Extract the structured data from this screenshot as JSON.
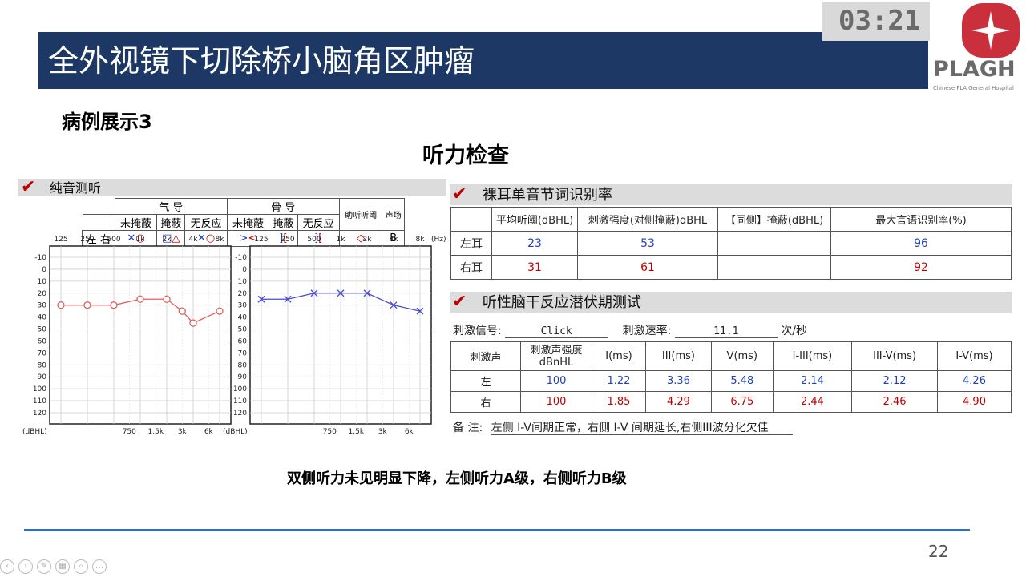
{
  "slide": {
    "title": "全外视镜下切除桥小脑角区肿瘤",
    "case_label": "病例展示3",
    "section_title": "听力检查",
    "summary": "双侧听力未见明显下降，左侧听力A级，右侧听力B级",
    "page_number": "22",
    "timer": "03:21"
  },
  "logo": {
    "text": "PLAGH",
    "subtext": "Chinese PLA General Hospital"
  },
  "pure_tone": {
    "header": "纯音测听",
    "legend": {
      "air": "气 导",
      "bone": "骨 导",
      "aid": "助听听阈",
      "field": "声场",
      "unmasked": "未掩蔽",
      "masked": "掩蔽",
      "no_response": "无反应",
      "left": "左",
      "right": "右",
      "field_symbol": "B"
    },
    "freq_labels": [
      "125",
      "250",
      "500",
      "1k",
      "2k",
      "4k",
      "8k"
    ],
    "hz": "(Hz)",
    "sub_freq_labels": [
      "750",
      "1.5k",
      "3k",
      "6k"
    ],
    "db_labels": [
      "-10",
      "0",
      "10",
      "20",
      "30",
      "40",
      "50",
      "60",
      "70",
      "80",
      "90",
      "100",
      "110",
      "120"
    ],
    "unit": "(dBHL)"
  },
  "chart_data": [
    {
      "type": "line",
      "title": "",
      "xlabel": "(Hz)",
      "ylabel": "(dBHL)",
      "x": [
        "125",
        "250",
        "500",
        "1k",
        "2k",
        "3k",
        "4k",
        "8k"
      ],
      "ylim": [
        -10,
        120
      ],
      "y_inverted": true,
      "series": [
        {
          "name": "右",
          "color": "#e06060",
          "values": [
            30,
            30,
            30,
            25,
            25,
            35,
            45,
            35
          ]
        }
      ]
    },
    {
      "type": "line",
      "title": "",
      "xlabel": "(Hz)",
      "ylabel": "(dBHL)",
      "x": [
        "125",
        "250",
        "500",
        "1k",
        "2k",
        "4k",
        "8k"
      ],
      "ylim": [
        -10,
        120
      ],
      "y_inverted": true,
      "series": [
        {
          "name": "左",
          "color": "#4a4ad0",
          "values": [
            25,
            25,
            20,
            20,
            20,
            30,
            35
          ]
        }
      ]
    }
  ],
  "speech": {
    "header": "裸耳单音节词识别率",
    "columns": [
      "",
      "平均听阈(dBHL)",
      "刺激强度(对侧掩蔽)dBHL",
      "【同侧】掩蔽(dBHL)",
      "最大言语识别率(%)"
    ],
    "rows": [
      {
        "ear": "左耳",
        "avg": "23",
        "intensity": "53",
        "mask": "",
        "max": "96"
      },
      {
        "ear": "右耳",
        "avg": "31",
        "intensity": "61",
        "mask": "",
        "max": "92"
      }
    ]
  },
  "abr": {
    "header": "听性脑干反应潜伏期测试",
    "signal_label": "刺激信号:",
    "signal_value": "Click",
    "rate_label": "刺激速率:",
    "rate_value": "11.1",
    "rate_unit": "次/秒",
    "columns": [
      "刺激声",
      "刺激声强度 dBnHL",
      "I(ms)",
      "III(ms)",
      "V(ms)",
      "I-III(ms)",
      "III-V(ms)",
      "I-V(ms)"
    ],
    "rows": [
      {
        "side": "左",
        "vals": [
          "100",
          "1.22",
          "3.36",
          "5.48",
          "2.14",
          "2.12",
          "4.26"
        ]
      },
      {
        "side": "右",
        "vals": [
          "100",
          "1.85",
          "4.29",
          "6.75",
          "2.44",
          "2.46",
          "4.90"
        ]
      }
    ],
    "note_label": "备    注:",
    "note": "左侧 I-V间期正常，右侧 I-V 间期延长,右侧III波分化欠佳"
  }
}
